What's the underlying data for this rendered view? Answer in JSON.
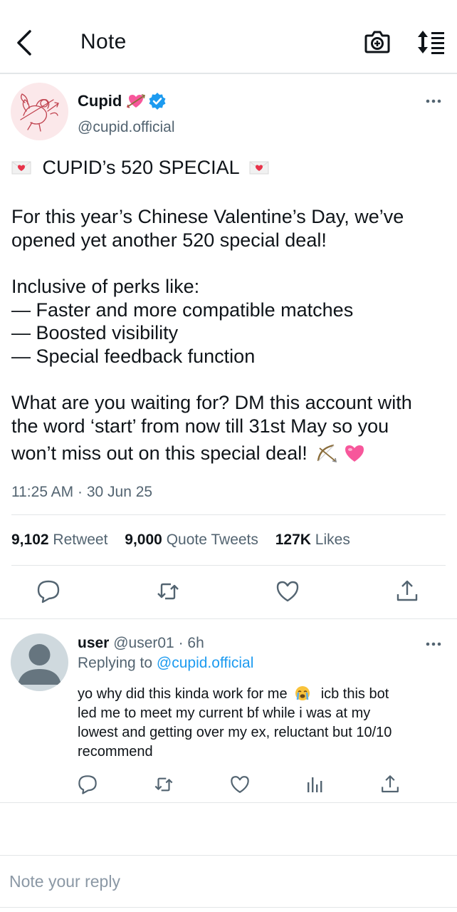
{
  "header": {
    "title": "Note",
    "back_icon": "chevron-left-icon",
    "camera_icon": "camera-icon",
    "sort_icon": "sort-list-icon"
  },
  "tweet": {
    "display_name": "Cupid",
    "name_emoji": "heart-with-arrow-icon",
    "verified_icon": "verified-badge-icon",
    "handle": "@cupid.official",
    "headline": "CUPID’s 520 SPECIAL",
    "paragraph1": [
      "For this year’s Chinese Valentine’s Day, we’ve",
      "opened yet another 520 special deal!"
    ],
    "perks_intro": "Inclusive of perks like:",
    "perks": [
      "— Faster and more compatible matches",
      "— Boosted visibility",
      "— Special feedback function"
    ],
    "paragraph3": [
      "What are you waiting for? DM this account with",
      "the word ‘start’ from now till 31st May so you",
      "won’t miss out on this special deal!"
    ],
    "timestamp": "11:25 AM · 30 Jun 25",
    "stats": {
      "retweets_count": "9,102",
      "retweets_label": "Retweet",
      "quotes_count": "9,000",
      "quotes_label": "Quote Tweets",
      "likes_count": "127K",
      "likes_label": "Likes"
    }
  },
  "reply": {
    "name": "user",
    "meta": "@user01 · 6h",
    "replying_prefix": "Replying to",
    "replying_to": "@cupid.official",
    "lines": [
      "yo why did this kinda work for me",
      "icb this bot",
      "led me to meet my current bf while i was at my",
      "lowest and getting over my ex, reluctant but 10/10",
      "recommend"
    ]
  },
  "composer": {
    "placeholder": "Note your reply"
  },
  "colors": {
    "accent": "#1d9bf0",
    "muted": "#536471",
    "divider": "#e3e6e8",
    "emoji_pink": "#f7579b"
  }
}
